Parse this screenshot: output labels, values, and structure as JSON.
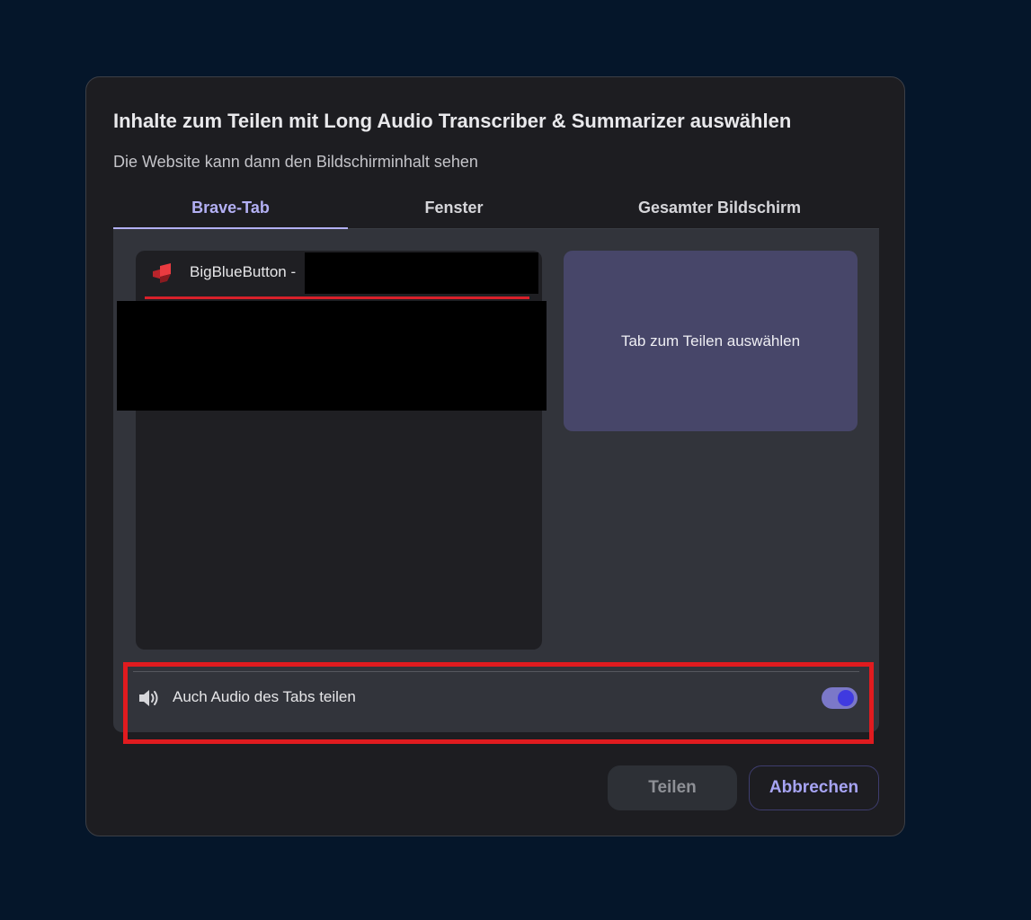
{
  "dialog": {
    "title": "Inhalte zum Teilen mit Long Audio Transcriber & Summarizer auswählen",
    "subtitle": "Die Website kann dann den Bildschirminhalt sehen"
  },
  "tabs": [
    {
      "label": "Brave-Tab",
      "active": true
    },
    {
      "label": "Fenster",
      "active": false
    },
    {
      "label": "Gesamter Bildschirm",
      "active": false
    }
  ],
  "tab_list": {
    "items": [
      {
        "title": "BigBlueButton -",
        "icon": "bigbluebutton-favicon",
        "selected": true
      }
    ]
  },
  "preview": {
    "placeholder": "Tab zum Teilen auswählen"
  },
  "audio": {
    "label": "Auch Audio des Tabs teilen",
    "icon": "speaker-icon",
    "enabled": true
  },
  "buttons": {
    "share_label": "Teilen",
    "cancel_label": "Abbrechen"
  },
  "colors": {
    "page_background": "#05162a",
    "dialog_background": "#1d1d21",
    "accent": "#b3b0f4",
    "highlight": "#e01b1f",
    "preview_background": "#474669"
  }
}
